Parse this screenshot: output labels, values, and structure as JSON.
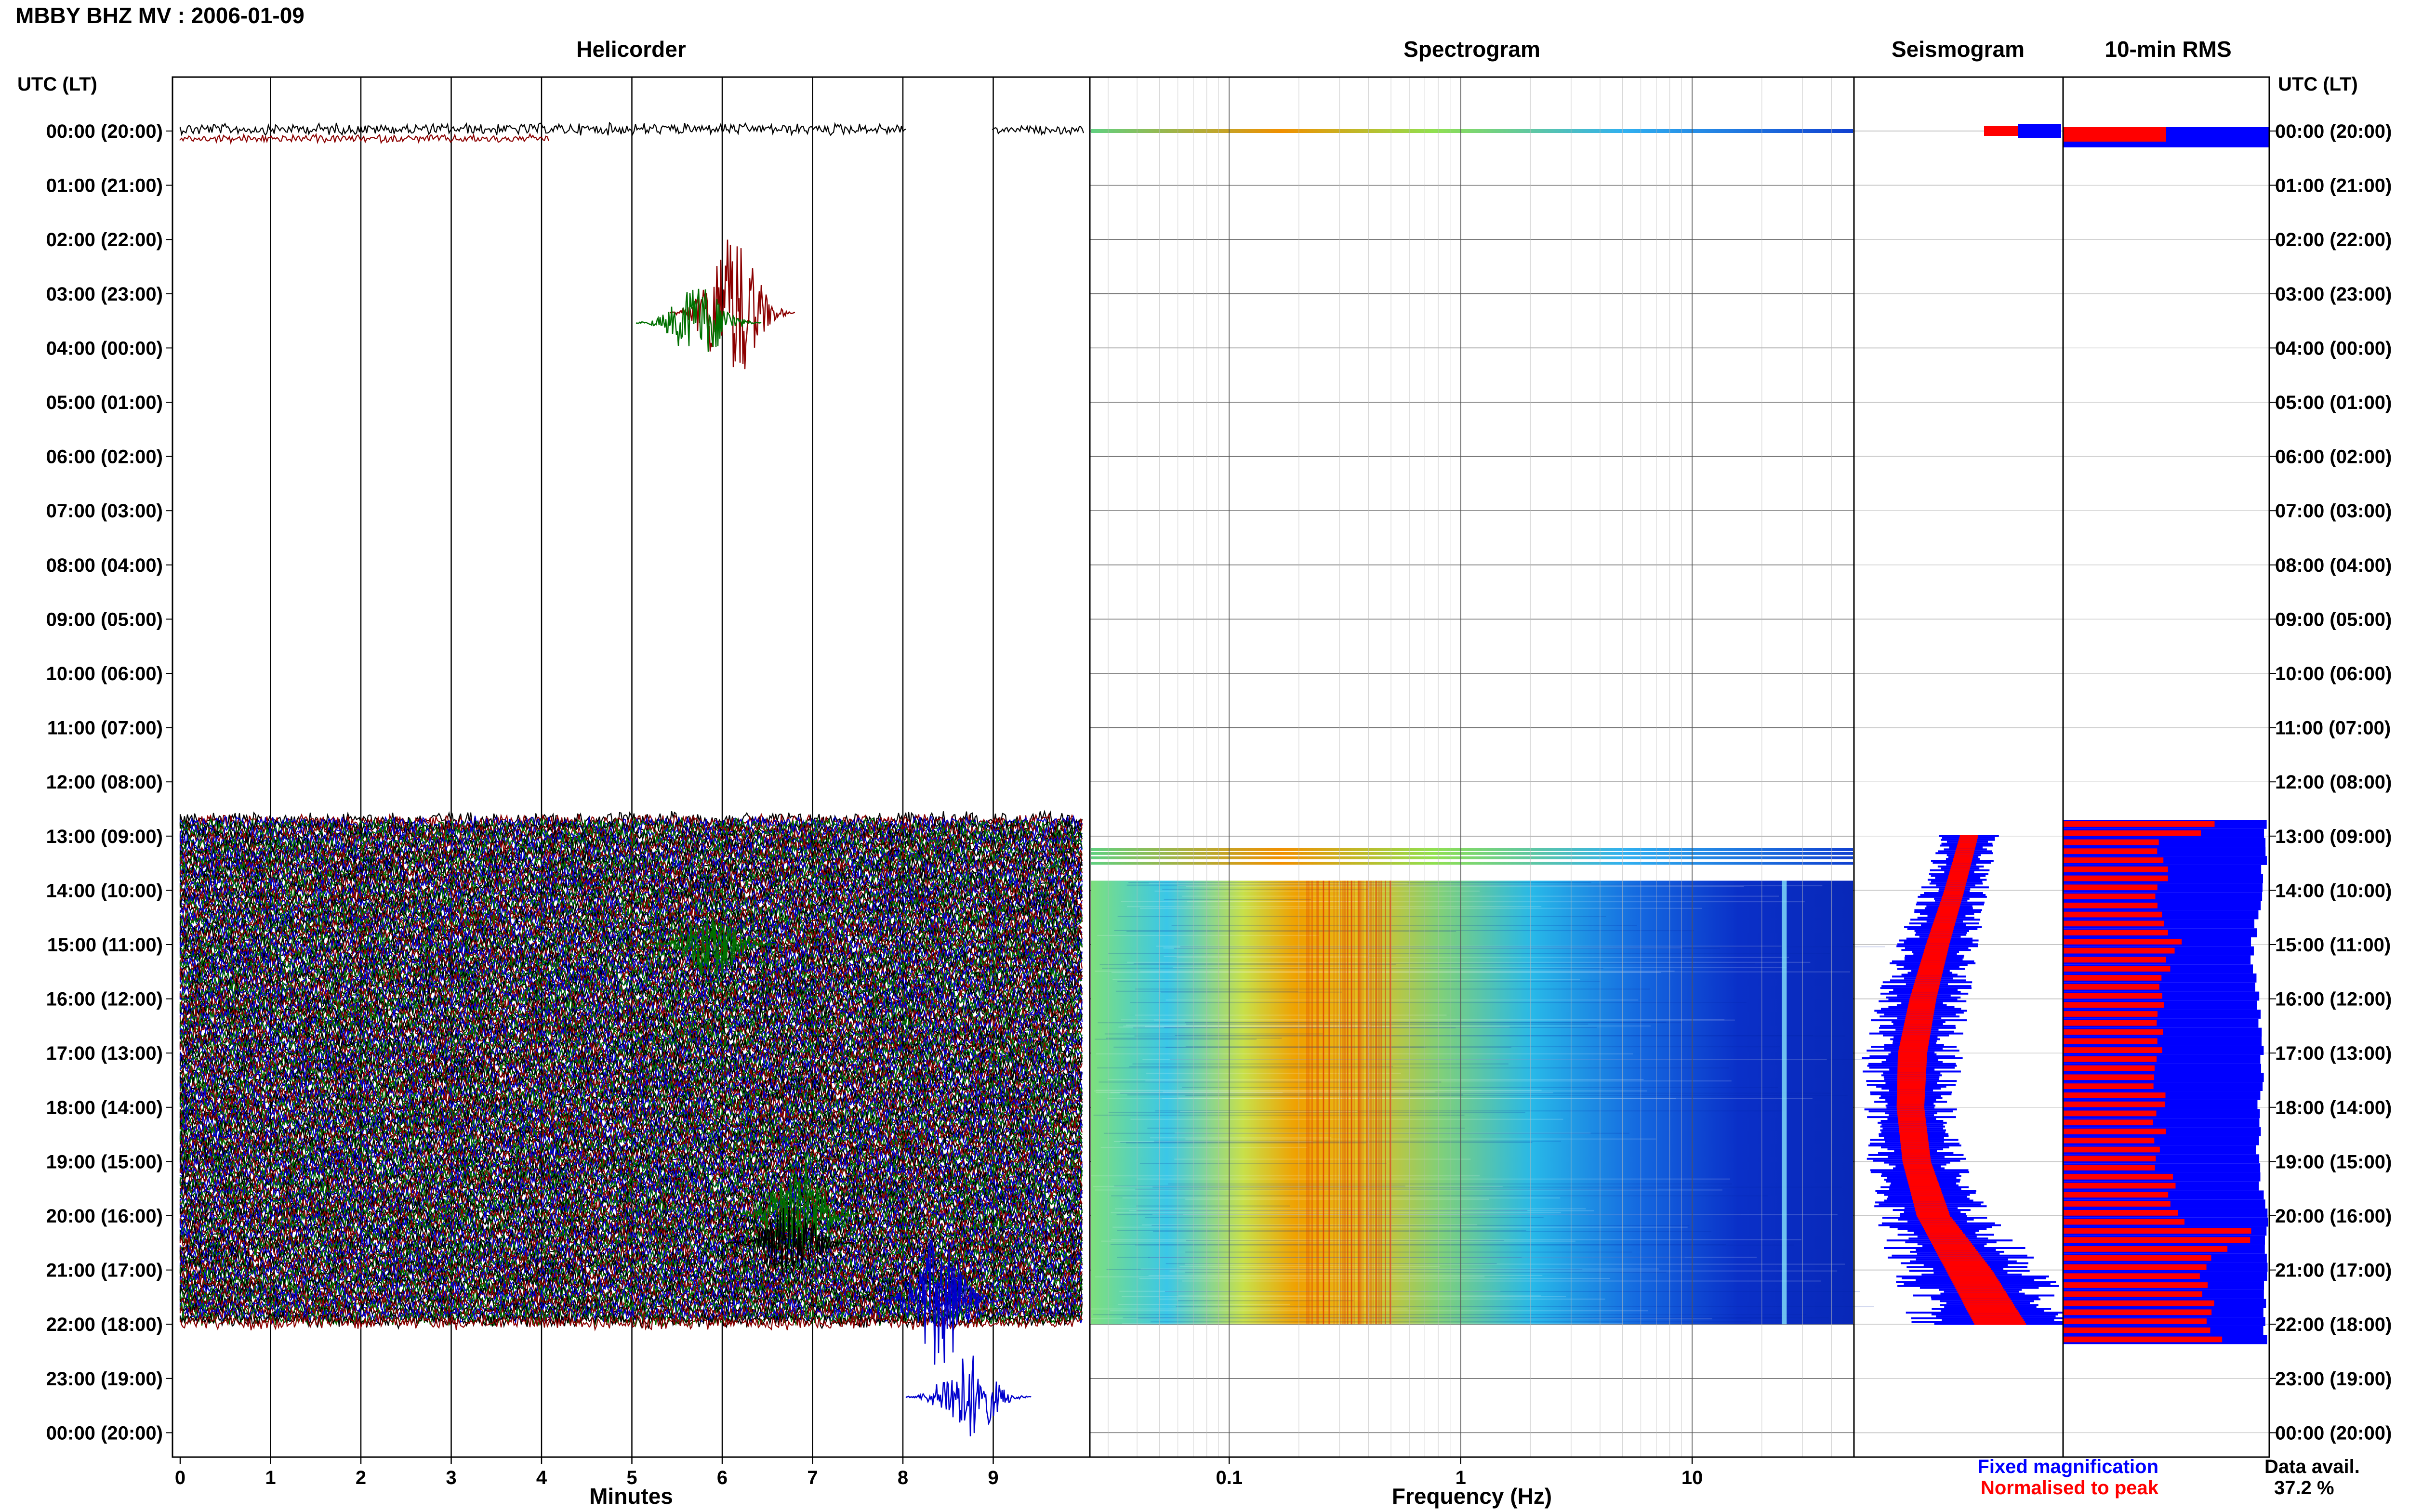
{
  "page_title": "MBBY BHZ MV : 2006-01-09",
  "panels": {
    "helicorder": "Helicorder",
    "spectrogram": "Spectrogram",
    "seismogram": "Seismogram",
    "rms": "10-min RMS"
  },
  "axis_headers": {
    "left": "UTC (LT)",
    "right": "UTC (LT)"
  },
  "row_labels": [
    "00:00 (20:00)",
    "01:00 (21:00)",
    "02:00 (22:00)",
    "03:00 (23:00)",
    "04:00 (00:00)",
    "05:00 (01:00)",
    "06:00 (02:00)",
    "07:00 (03:00)",
    "08:00 (04:00)",
    "09:00 (05:00)",
    "10:00 (06:00)",
    "11:00 (07:00)",
    "12:00 (08:00)",
    "13:00 (09:00)",
    "14:00 (10:00)",
    "15:00 (11:00)",
    "16:00 (12:00)",
    "17:00 (13:00)",
    "18:00 (14:00)",
    "19:00 (15:00)",
    "20:00 (16:00)",
    "21:00 (17:00)",
    "22:00 (18:00)",
    "23:00 (19:00)",
    "00:00 (20:00)"
  ],
  "x_axes": {
    "helicorder": {
      "label": "Minutes",
      "ticks": [
        "0",
        "1",
        "2",
        "3",
        "4",
        "5",
        "6",
        "7",
        "8",
        "9"
      ]
    },
    "spectrogram": {
      "label": "Frequency (Hz)",
      "ticks": [
        "0.1",
        "1",
        "10"
      ],
      "scale": "log",
      "range": [
        0.025,
        50
      ]
    }
  },
  "legend": {
    "fixed": "Fixed magnification",
    "normalised": "Normalised to peak"
  },
  "data_availability": {
    "label": "Data avail.",
    "value": "37.2 %"
  },
  "colors": {
    "trace_cycle": [
      "#000000",
      "#8b0000",
      "#0000cc",
      "#007000"
    ],
    "fixed": "#0000ff",
    "normalised": "#ff0000"
  },
  "chart_data": {
    "type": "heatmap",
    "time_axis": "hours UTC, 0 at top",
    "data_segments_hours": [
      [
        0.0,
        0.3
      ],
      [
        12.7,
        22.0
      ]
    ],
    "spectrogram_dominant_band_hz": [
      0.2,
      0.5
    ],
    "spectrogram_spike_hz": 25,
    "seismogram_envelope": {
      "hours": [
        13.0,
        14.0,
        15.0,
        16.0,
        17.0,
        18.0,
        19.0,
        20.0,
        21.0,
        22.0
      ],
      "fixed_half_width": [
        0.22,
        0.24,
        0.28,
        0.32,
        0.35,
        0.33,
        0.34,
        0.4,
        0.55,
        0.62
      ],
      "center": [
        0.55,
        0.48,
        0.4,
        0.33,
        0.28,
        0.27,
        0.3,
        0.38,
        0.55,
        0.7
      ]
    },
    "rms_10min": {
      "hours": [
        0.0,
        13.0,
        14.0,
        15.0,
        16.0,
        17.0,
        18.0,
        19.0,
        20.0,
        20.2,
        21.0,
        21.7,
        22.0
      ],
      "normalised": [
        0.5,
        0.5,
        0.48,
        0.55,
        0.46,
        0.48,
        0.47,
        0.48,
        0.55,
        0.99,
        0.65,
        0.75,
        0.72
      ],
      "fixed": [
        1.0,
        1.0,
        0.97,
        0.93,
        0.96,
        0.98,
        0.97,
        0.96,
        1.0,
        1.0,
        1.0,
        1.0,
        1.0
      ]
    }
  }
}
